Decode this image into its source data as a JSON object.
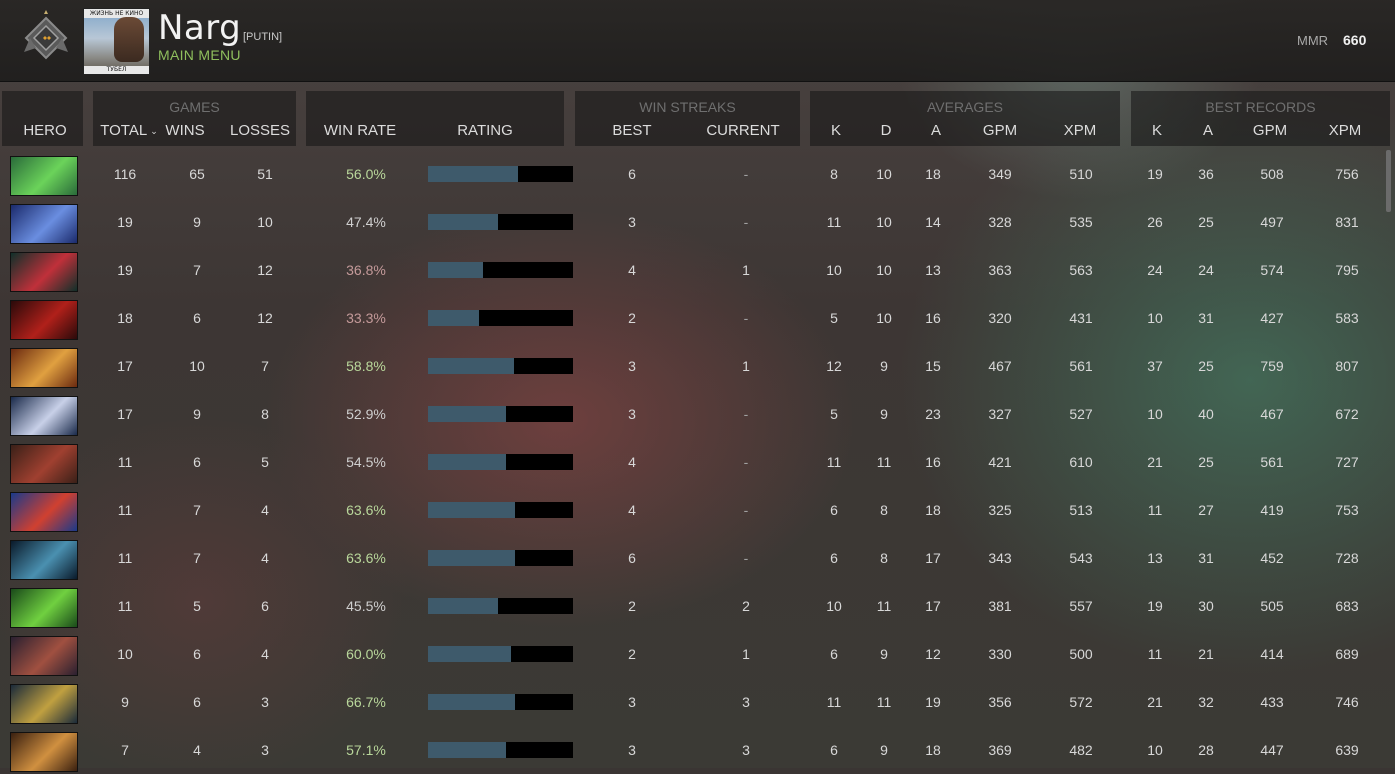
{
  "header": {
    "player_name": "Narg",
    "player_tag": "[PUTIN]",
    "main_menu": "MAIN MENU",
    "mmr_label": "MMR",
    "mmr_value": "660",
    "avatar_caption_top": "ЖИЗНЬ НЕ КИНО",
    "avatar_caption_bottom": "ТУБЕЛ"
  },
  "groups": {
    "games": "GAMES",
    "win_streaks": "WIN STREAKS",
    "averages": "AVERAGES",
    "best_records": "BEST RECORDS"
  },
  "columns": {
    "hero": "HERO",
    "total": "TOTAL",
    "wins": "WINS",
    "losses": "LOSSES",
    "win_rate": "WIN RATE",
    "rating": "RATING",
    "best": "BEST",
    "current": "CURRENT",
    "k": "K",
    "d": "D",
    "a": "A",
    "gpm": "GPM",
    "xpm": "XPM",
    "best_k": "K",
    "best_a": "A",
    "best_gpm": "GPM",
    "best_xpm": "XPM"
  },
  "colors": {
    "win_rate_high": "#b9d79b",
    "win_rate_low": "#c49a9a",
    "rating_fill": "#3e5a6b",
    "main_menu": "#8fbf5d"
  },
  "rows": [
    {
      "hero_icon": "hero-portrait-icon",
      "portrait": [
        "#2a6b3a",
        "#6bd35a"
      ],
      "total": "116",
      "wins": "65",
      "losses": "51",
      "win_rate": "56.0%",
      "rating": 0.62,
      "best": "6",
      "current": "-",
      "k": "8",
      "d": "10",
      "a": "18",
      "gpm": "349",
      "xpm": "510",
      "bk": "19",
      "ba": "36",
      "bgpm": "508",
      "bxpm": "756"
    },
    {
      "hero_icon": "hero-portrait-icon",
      "portrait": [
        "#1b2a6b",
        "#6a8ee0"
      ],
      "total": "19",
      "wins": "9",
      "losses": "10",
      "win_rate": "47.4%",
      "rating": 0.48,
      "best": "3",
      "current": "-",
      "k": "11",
      "d": "10",
      "a": "14",
      "gpm": "328",
      "xpm": "535",
      "bk": "26",
      "ba": "25",
      "bgpm": "497",
      "bxpm": "831"
    },
    {
      "hero_icon": "hero-portrait-icon",
      "portrait": [
        "#10302a",
        "#c0303a"
      ],
      "total": "19",
      "wins": "7",
      "losses": "12",
      "win_rate": "36.8%",
      "rating": 0.38,
      "best": "4",
      "current": "1",
      "k": "10",
      "d": "10",
      "a": "13",
      "gpm": "363",
      "xpm": "563",
      "bk": "24",
      "ba": "24",
      "bgpm": "574",
      "bxpm": "795"
    },
    {
      "hero_icon": "hero-portrait-icon",
      "portrait": [
        "#2a0a0a",
        "#b0201a"
      ],
      "total": "18",
      "wins": "6",
      "losses": "12",
      "win_rate": "33.3%",
      "rating": 0.35,
      "best": "2",
      "current": "-",
      "k": "5",
      "d": "10",
      "a": "16",
      "gpm": "320",
      "xpm": "431",
      "bk": "10",
      "ba": "31",
      "bgpm": "427",
      "bxpm": "583"
    },
    {
      "hero_icon": "hero-portrait-icon",
      "portrait": [
        "#6b2a10",
        "#e0a040"
      ],
      "total": "17",
      "wins": "10",
      "losses": "7",
      "win_rate": "58.8%",
      "rating": 0.59,
      "best": "3",
      "current": "1",
      "k": "12",
      "d": "9",
      "a": "15",
      "gpm": "467",
      "xpm": "561",
      "bk": "37",
      "ba": "25",
      "bgpm": "759",
      "bxpm": "807"
    },
    {
      "hero_icon": "hero-portrait-icon",
      "portrait": [
        "#1a2a4a",
        "#c8d0e8"
      ],
      "total": "17",
      "wins": "9",
      "losses": "8",
      "win_rate": "52.9%",
      "rating": 0.54,
      "best": "3",
      "current": "-",
      "k": "5",
      "d": "9",
      "a": "23",
      "gpm": "327",
      "xpm": "527",
      "bk": "10",
      "ba": "40",
      "bgpm": "467",
      "bxpm": "672"
    },
    {
      "hero_icon": "hero-portrait-icon",
      "portrait": [
        "#3a2018",
        "#a04030"
      ],
      "total": "11",
      "wins": "6",
      "losses": "5",
      "win_rate": "54.5%",
      "rating": 0.54,
      "best": "4",
      "current": "-",
      "k": "11",
      "d": "11",
      "a": "16",
      "gpm": "421",
      "xpm": "610",
      "bk": "21",
      "ba": "25",
      "bgpm": "561",
      "bxpm": "727"
    },
    {
      "hero_icon": "hero-portrait-icon",
      "portrait": [
        "#1a3a8a",
        "#d04030"
      ],
      "total": "11",
      "wins": "7",
      "losses": "4",
      "win_rate": "63.6%",
      "rating": 0.6,
      "best": "4",
      "current": "-",
      "k": "6",
      "d": "8",
      "a": "18",
      "gpm": "325",
      "xpm": "513",
      "bk": "11",
      "ba": "27",
      "bgpm": "419",
      "bxpm": "753"
    },
    {
      "hero_icon": "hero-portrait-icon",
      "portrait": [
        "#0a1a2a",
        "#4a90b0"
      ],
      "total": "11",
      "wins": "7",
      "losses": "4",
      "win_rate": "63.6%",
      "rating": 0.6,
      "best": "6",
      "current": "-",
      "k": "6",
      "d": "8",
      "a": "17",
      "gpm": "343",
      "xpm": "543",
      "bk": "13",
      "ba": "31",
      "bgpm": "452",
      "bxpm": "728"
    },
    {
      "hero_icon": "hero-portrait-icon",
      "portrait": [
        "#1a4a1a",
        "#70d040"
      ],
      "total": "11",
      "wins": "5",
      "losses": "6",
      "win_rate": "45.5%",
      "rating": 0.48,
      "best": "2",
      "current": "2",
      "k": "10",
      "d": "11",
      "a": "17",
      "gpm": "381",
      "xpm": "557",
      "bk": "19",
      "ba": "30",
      "bgpm": "505",
      "bxpm": "683"
    },
    {
      "hero_icon": "hero-portrait-icon",
      "portrait": [
        "#2a2030",
        "#a05040"
      ],
      "total": "10",
      "wins": "6",
      "losses": "4",
      "win_rate": "60.0%",
      "rating": 0.57,
      "best": "2",
      "current": "1",
      "k": "6",
      "d": "9",
      "a": "12",
      "gpm": "330",
      "xpm": "500",
      "bk": "11",
      "ba": "21",
      "bgpm": "414",
      "bxpm": "689"
    },
    {
      "hero_icon": "hero-portrait-icon",
      "portrait": [
        "#1a2a3a",
        "#c0a040"
      ],
      "total": "9",
      "wins": "6",
      "losses": "3",
      "win_rate": "66.7%",
      "rating": 0.6,
      "best": "3",
      "current": "3",
      "k": "11",
      "d": "11",
      "a": "19",
      "gpm": "356",
      "xpm": "572",
      "bk": "21",
      "ba": "32",
      "bgpm": "433",
      "bxpm": "746"
    },
    {
      "hero_icon": "hero-portrait-icon",
      "portrait": [
        "#3a2010",
        "#d09040"
      ],
      "total": "7",
      "wins": "4",
      "losses": "3",
      "win_rate": "57.1%",
      "rating": 0.54,
      "best": "3",
      "current": "3",
      "k": "6",
      "d": "9",
      "a": "18",
      "gpm": "369",
      "xpm": "482",
      "bk": "10",
      "ba": "28",
      "bgpm": "447",
      "bxpm": "639"
    }
  ]
}
